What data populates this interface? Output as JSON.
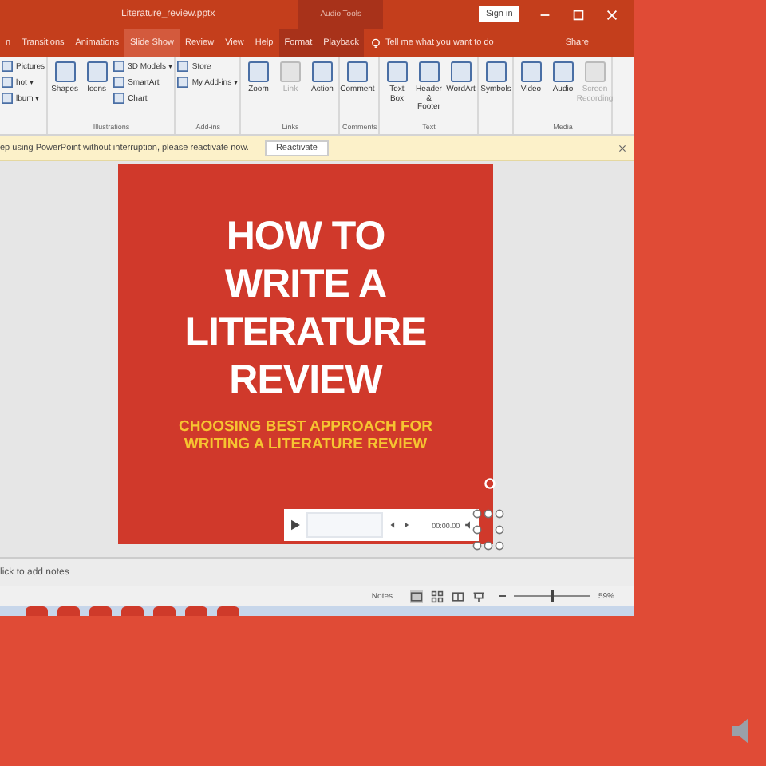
{
  "title_bar": {
    "file_name": "Literature_review.pptx",
    "context_label": "Audio Tools",
    "sign_in": "Sign in"
  },
  "tabs": [
    {
      "label": "n",
      "highlighted": false,
      "contextual": false
    },
    {
      "label": "Transitions",
      "highlighted": false,
      "contextual": false
    },
    {
      "label": "Animations",
      "highlighted": false,
      "contextual": false
    },
    {
      "label": "Slide Show",
      "highlighted": true,
      "contextual": false
    },
    {
      "label": "Review",
      "highlighted": false,
      "contextual": false
    },
    {
      "label": "View",
      "highlighted": false,
      "contextual": false
    },
    {
      "label": "Help",
      "highlighted": false,
      "contextual": false
    },
    {
      "label": "Format",
      "highlighted": false,
      "contextual": true
    },
    {
      "label": "Playback",
      "highlighted": false,
      "contextual": true
    }
  ],
  "tell_me": "Tell me what you want to do",
  "share": "Share",
  "ribbon_groups": [
    {
      "buttons": [
        {
          "label": "Pictures",
          "kind": "small",
          "disabled": false
        },
        {
          "label": "hot ▾",
          "kind": "small",
          "disabled": false
        },
        {
          "label": "lbum ▾",
          "kind": "small",
          "disabled": false
        }
      ]
    },
    {
      "name": "Illustrations",
      "buttons": [
        {
          "label": "Shapes",
          "kind": "large",
          "disabled": false
        },
        {
          "label": "Icons",
          "kind": "large",
          "disabled": false
        },
        {
          "label": "3D Models ▾",
          "kind": "small",
          "disabled": false
        },
        {
          "label": "SmartArt",
          "kind": "small",
          "disabled": false
        },
        {
          "label": "Chart",
          "kind": "small",
          "disabled": false
        }
      ]
    },
    {
      "name": "Add-ins",
      "buttons": [
        {
          "label": "Store",
          "kind": "small",
          "disabled": false
        },
        {
          "label": "My Add-ins ▾",
          "kind": "small",
          "disabled": false
        }
      ]
    },
    {
      "name": "Links",
      "buttons": [
        {
          "label": "Zoom",
          "kind": "large",
          "disabled": false
        },
        {
          "label": "Link",
          "kind": "large",
          "disabled": true
        },
        {
          "label": "Action",
          "kind": "large",
          "disabled": false
        }
      ]
    },
    {
      "name": "Comments",
      "buttons": [
        {
          "label": "Comment",
          "kind": "large",
          "disabled": false
        }
      ]
    },
    {
      "name": "Text",
      "buttons": [
        {
          "label": "Text Box",
          "kind": "large",
          "disabled": false
        },
        {
          "label": "Header & Footer",
          "kind": "large",
          "disabled": false
        },
        {
          "label": "WordArt",
          "kind": "large",
          "disabled": false
        }
      ]
    },
    {
      "buttons": [
        {
          "label": "Symbols",
          "kind": "large",
          "disabled": false
        }
      ]
    },
    {
      "name": "Media",
      "buttons": [
        {
          "label": "Video",
          "kind": "large",
          "disabled": false
        },
        {
          "label": "Audio",
          "kind": "large",
          "disabled": false
        },
        {
          "label": "Screen Recording",
          "kind": "large",
          "disabled": true
        }
      ]
    }
  ],
  "warning": {
    "message": "ep using PowerPoint without interruption, please reactivate now.",
    "button": "Reactivate"
  },
  "slide": {
    "title_lines": [
      "HOW TO",
      "WRITE A",
      "LITERATURE",
      "REVIEW"
    ],
    "subtitle_lines": [
      "CHOOSING BEST APPROACH FOR",
      "WRITING A LITERATURE REVIEW"
    ]
  },
  "player": {
    "time": "00:00.00"
  },
  "notes_placeholder": "lick to add notes",
  "status_bar": {
    "notes": "Notes",
    "zoom": "59%",
    "zoom_slider": {
      "level": 0.5
    }
  }
}
